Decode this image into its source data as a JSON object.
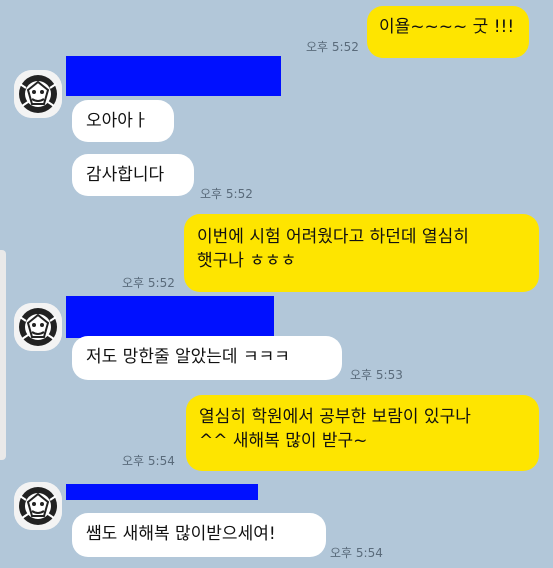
{
  "colors": {
    "background": "#b2c7d9",
    "outgoing_bubble": "#fee500",
    "incoming_bubble": "#ffffff",
    "redaction": "#0010ff"
  },
  "icons": {
    "avatar": "profile-avatar-icon"
  },
  "messages": [
    {
      "direction": "outgoing",
      "text": "이욜~~~~ 굿 !!!",
      "time": "오후 5:52"
    },
    {
      "direction": "incoming",
      "text": "오아아ㅏ",
      "time": ""
    },
    {
      "direction": "incoming",
      "text": "감사합니다",
      "time": "오후 5:52"
    },
    {
      "direction": "outgoing",
      "text": "이번에 시험 어려웠다고 하던데 열심히\n햇구나 ㅎㅎㅎ",
      "time": "오후 5:52"
    },
    {
      "direction": "incoming",
      "text": "저도 망한줄 알았는데 ㅋㅋㅋ",
      "time": "오후 5:53"
    },
    {
      "direction": "outgoing",
      "text": "열심히 학원에서 공부한 보람이 있구나\n^^ 새해복 많이 받구~",
      "time": "오후 5:54"
    },
    {
      "direction": "incoming",
      "text": "쌤도 새해복 많이받으세여!",
      "time": "오후 5:54"
    }
  ]
}
